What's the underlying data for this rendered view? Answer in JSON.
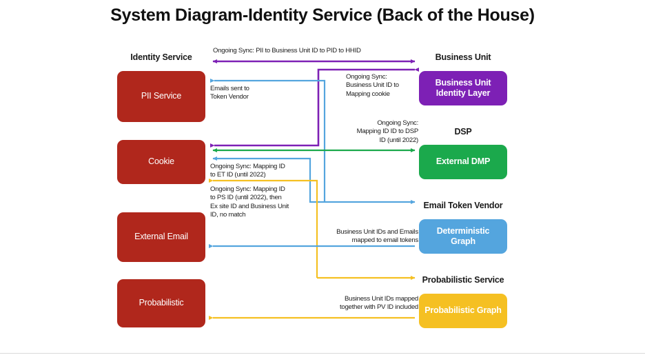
{
  "title": "System Diagram-Identity Service (Back of the House)",
  "colors": {
    "red": "#B0271C",
    "purple": "#7D20B5",
    "green": "#1BA94C",
    "blue": "#54A5DE",
    "yellow": "#F5C022",
    "text": "#1a1a1a",
    "footer_rule": "#d9d9d9"
  },
  "columns": {
    "left_headers": [
      {
        "label": "Identity Service"
      }
    ],
    "right_headers": [
      {
        "label": "Business Unit"
      },
      {
        "label": "DSP"
      },
      {
        "label": "Email Token Vendor"
      },
      {
        "label": "Probabilistic Service"
      }
    ]
  },
  "left_nodes": [
    {
      "label": "PII Service",
      "color": "#B0271C"
    },
    {
      "label": "Cookie",
      "color": "#B0271C"
    },
    {
      "label": "External Email",
      "color": "#B0271C"
    },
    {
      "label": "Probabilistic",
      "color": "#B0271C"
    }
  ],
  "right_nodes": [
    {
      "label": "Business Unit\nIdentity Layer",
      "color": "#7D20B5"
    },
    {
      "label": "External DMP",
      "color": "#1BA94C"
    },
    {
      "label": "Deterministic Graph",
      "color": "#54A5DE"
    },
    {
      "label": "Probabilistic Graph",
      "color": "#F5C022"
    }
  ],
  "connector_labels": [
    {
      "id": "sync-pii-hhid",
      "text": "Ongoing Sync: PII to Business Unit ID to PID to HHID",
      "align": "left"
    },
    {
      "id": "sync-bu-mapping-cookie",
      "text": "Ongoing Sync:\nBusiness Unit ID to\nMapping cookie",
      "align": "left"
    },
    {
      "id": "emails-sent-token-vendor",
      "text": "Emails sent to\nToken Vendor",
      "align": "left"
    },
    {
      "id": "sync-mapping-dsp",
      "text": "Ongoing Sync:\nMapping ID ID to DSP\nID (until 2022)",
      "align": "right"
    },
    {
      "id": "sync-mapping-etid",
      "text": "Ongoing Sync: Mapping ID\nto ET ID (until 2022)",
      "align": "left"
    },
    {
      "id": "sync-mapping-psid",
      "text": "Ongoing Sync: Mapping ID\nto PS ID (until 2022), then\nEx site ID and Business Unit\nID, no match",
      "align": "left"
    },
    {
      "id": "bu-ids-emails-tokens",
      "text": "Business Unit IDs and Emails\nmapped to email tokens",
      "align": "right"
    },
    {
      "id": "bu-ids-pv-id",
      "text": "Business Unit IDs mapped\ntogether with PV ID included",
      "align": "right"
    }
  ],
  "connectors": [
    {
      "id": "arrow-pii-hhid",
      "color": "#7D20B5",
      "heads": "both"
    },
    {
      "id": "arrow-bu-mapping-cookie",
      "color": "#7D20B5",
      "heads": "right"
    },
    {
      "id": "arrow-emails-token-vendor",
      "color": "#54A5DE",
      "heads": "left"
    },
    {
      "id": "arrow-mapping-dsp",
      "color": "#1BA94C",
      "heads": "both"
    },
    {
      "id": "arrow-mapping-etid",
      "color": "#54A5DE",
      "heads": "both"
    },
    {
      "id": "arrow-mapping-psid",
      "color": "#F5C022",
      "heads": "left"
    },
    {
      "id": "arrow-bu-ids-emails-tokens",
      "color": "#54A5DE",
      "heads": "left"
    },
    {
      "id": "arrow-bu-ids-pv-id",
      "color": "#F5C022",
      "heads": "left"
    }
  ]
}
